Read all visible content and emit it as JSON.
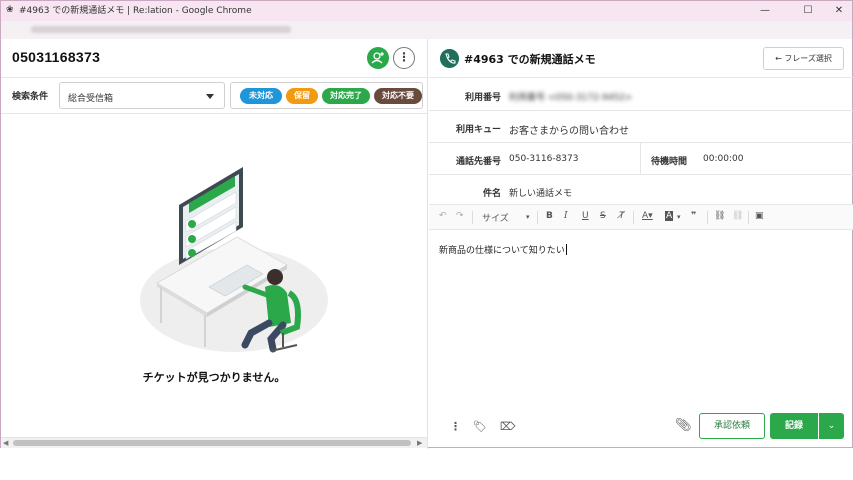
{
  "window": {
    "title": "#4963 での新規通話メモ | Re:lation - Google Chrome",
    "favicon": "relation-icon"
  },
  "left": {
    "phone_number": "05031168373",
    "filter_label": "検索条件",
    "filter_value": "総合受信箱",
    "status_chips": [
      {
        "label": "未対応",
        "color": "#1e96d8"
      },
      {
        "label": "保留",
        "color": "#f29a12"
      },
      {
        "label": "対応完了",
        "color": "#2aa84a"
      },
      {
        "label": "対応不要",
        "color": "#6b4a3e"
      }
    ],
    "empty_message": "チケットが見つかりません。"
  },
  "right": {
    "title": "#4963 での新規通話メモ",
    "phrase_button": "フレーズ選択",
    "fields": {
      "usage_number_label": "利用番号",
      "usage_number_value": "利用番号 <050-3172-9452>",
      "queue_label": "利用キュー",
      "queue_value": "お客さまからの問い合わせ",
      "callee_label": "通話先番号",
      "callee_value": "050-3116-8373",
      "wait_label": "待機時間",
      "wait_value": "00:00:00",
      "subject_label": "件名",
      "subject_value": "新しい通話メモ"
    },
    "toolbar": {
      "size_label": "サイズ"
    },
    "editor_text": "新商品の仕様について知りたい",
    "approve_button": "承認依頼",
    "record_button": "記録"
  },
  "colors": {
    "accent_green": "#2aa84a",
    "titlebar_bg": "#f7e6f1"
  }
}
